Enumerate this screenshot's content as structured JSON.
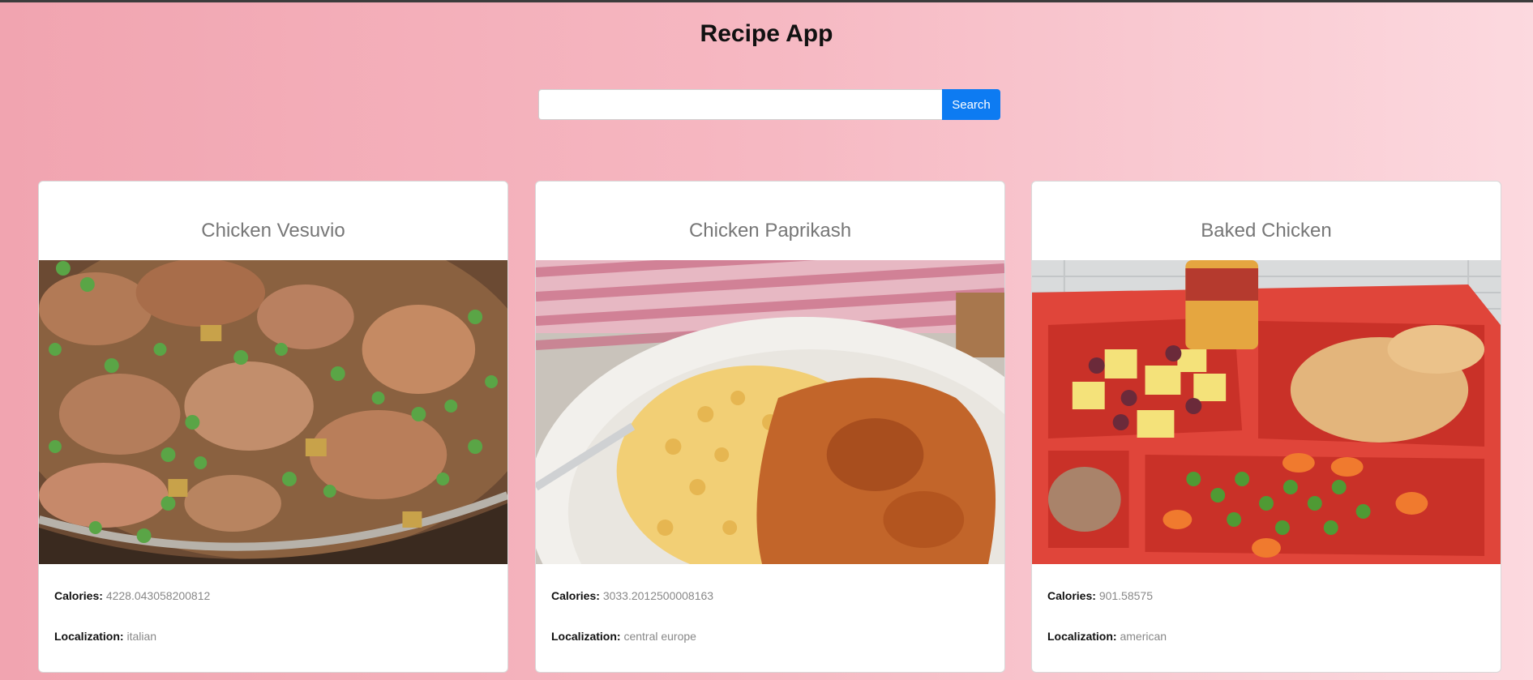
{
  "app": {
    "title": "Recipe App"
  },
  "search": {
    "value": "",
    "placeholder": "",
    "button_label": "Search"
  },
  "labels": {
    "calories": "Calories:",
    "localization": "Localization:"
  },
  "recipes": [
    {
      "title": "Chicken Vesuvio",
      "calories": "4228.043058200812",
      "localization": "italian",
      "image": "chicken-vesuvio-photo"
    },
    {
      "title": "Chicken Paprikash",
      "calories": "3033.2012500008163",
      "localization": "central europe",
      "image": "chicken-paprikash-photo"
    },
    {
      "title": "Baked Chicken",
      "calories": "901.58575",
      "localization": "american",
      "image": "baked-chicken-photo"
    }
  ],
  "colors": {
    "background_start": "#f1a4b0",
    "background_end": "#fcd9df",
    "search_button": "#0d7bf2",
    "card_title": "#777777"
  }
}
